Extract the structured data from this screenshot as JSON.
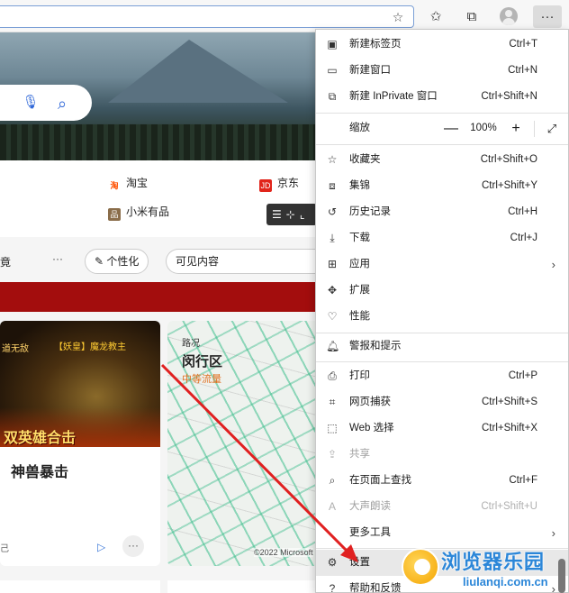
{
  "toolbar": {
    "icons": [
      "favorite-star-icon",
      "favorites-icon",
      "collections-icon",
      "profile-icon",
      "more-icon"
    ],
    "more_label": "···"
  },
  "page": {
    "quick_links": [
      {
        "label": "淘宝",
        "icon": "淘",
        "color": "#ff5000"
      },
      {
        "label": "京东",
        "icon": "JD",
        "color": "#e1251b"
      },
      {
        "label": "小米有品",
        "icon": "品",
        "color": "#8a6d4a"
      }
    ],
    "filter": {
      "partial_label": "竟",
      "ellipsis": "···",
      "personalize_label": "个性化",
      "visible_content_label": "可见内容"
    },
    "game_card": {
      "tag_left": "道无敌",
      "tag_right": "【妖皇】魔龙教主",
      "caption": "双英雄合击",
      "title": "神兽暴击",
      "source": "己",
      "more": "···"
    },
    "map_card": {
      "kicker": "路况",
      "title": "闵行区",
      "status": "中等流量",
      "copyright": "©2022 Microsoft"
    }
  },
  "menu": {
    "items": [
      {
        "label": "新建标签页",
        "shortcut": "Ctrl+T",
        "icon": "new-tab-icon",
        "glyph": "▣"
      },
      {
        "label": "新建窗口",
        "shortcut": "Ctrl+N",
        "icon": "new-window-icon",
        "glyph": "▭"
      },
      {
        "label": "新建 InPrivate 窗口",
        "shortcut": "Ctrl+Shift+N",
        "icon": "inprivate-icon",
        "glyph": "⧉"
      }
    ],
    "zoom": {
      "label": "缩放",
      "value": "100%",
      "minus": "—",
      "plus": "+",
      "fullscreen": "⤢"
    },
    "items2": [
      {
        "label": "收藏夹",
        "shortcut": "Ctrl+Shift+O",
        "icon": "favorites-icon",
        "glyph": "☆"
      },
      {
        "label": "集锦",
        "shortcut": "Ctrl+Shift+Y",
        "icon": "collections-icon",
        "glyph": "⧈"
      },
      {
        "label": "历史记录",
        "shortcut": "Ctrl+H",
        "icon": "history-icon",
        "glyph": "↺"
      },
      {
        "label": "下载",
        "shortcut": "Ctrl+J",
        "icon": "download-icon",
        "glyph": "⤓"
      },
      {
        "label": "应用",
        "shortcut": "",
        "icon": "apps-icon",
        "glyph": "⊞",
        "arrow": "›"
      },
      {
        "label": "扩展",
        "shortcut": "",
        "icon": "extensions-icon",
        "glyph": "✥"
      },
      {
        "label": "性能",
        "shortcut": "",
        "icon": "performance-icon",
        "glyph": "♡"
      }
    ],
    "items3": [
      {
        "label": "警报和提示",
        "shortcut": "",
        "icon": "alerts-icon",
        "glyph": "🔔︎"
      }
    ],
    "items4": [
      {
        "label": "打印",
        "shortcut": "Ctrl+P",
        "icon": "print-icon",
        "glyph": "⎙"
      },
      {
        "label": "网页捕获",
        "shortcut": "Ctrl+Shift+S",
        "icon": "web-capture-icon",
        "glyph": "⌗"
      },
      {
        "label": "Web 选择",
        "shortcut": "Ctrl+Shift+X",
        "icon": "web-select-icon",
        "glyph": "⬚"
      },
      {
        "label": "共享",
        "shortcut": "",
        "icon": "share-icon",
        "glyph": "⇪",
        "disabled": true
      },
      {
        "label": "在页面上查找",
        "shortcut": "Ctrl+F",
        "icon": "find-icon",
        "glyph": "⌕"
      },
      {
        "label": "大声朗读",
        "shortcut": "Ctrl+Shift+U",
        "icon": "read-aloud-icon",
        "glyph": "A",
        "disabled": true
      },
      {
        "label": "更多工具",
        "shortcut": "",
        "icon": "more-tools-icon",
        "glyph": "",
        "arrow": "›"
      }
    ],
    "items5": [
      {
        "label": "设置",
        "shortcut": "",
        "icon": "settings-icon",
        "glyph": "⚙"
      },
      {
        "label": "帮助和反馈",
        "shortcut": "",
        "icon": "help-icon",
        "glyph": "?",
        "arrow": "›"
      }
    ]
  },
  "watermark": {
    "title": "浏览器乐园",
    "url": "liulanqi.com.cn"
  }
}
